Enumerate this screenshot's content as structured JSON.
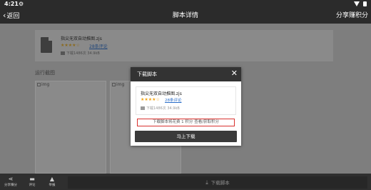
{
  "status_bar": {
    "time": "4:21",
    "settings_icon": "gear-icon",
    "wifi_icon": "wifi-icon",
    "battery_icon": "battery-icon"
  },
  "header": {
    "back_label": "返回",
    "title": "脚本详情",
    "share_label": "分享赚积分"
  },
  "script": {
    "name": "指尖无双自动推图.zjs",
    "stars": "★★★★☆",
    "comments": "28条评论",
    "downloads": "下载1486次 34.9kB"
  },
  "screenshots": {
    "label": "运行截图",
    "alt_text": "img"
  },
  "bottom_bar": {
    "items": [
      {
        "icon": "share-icon",
        "label": "分享赚分"
      },
      {
        "icon": "comment-icon",
        "label": "评论"
      },
      {
        "icon": "report-icon",
        "label": "举报"
      }
    ],
    "download_label": "下载脚本"
  },
  "dialog": {
    "title": "下载脚本",
    "close_icon": "close-icon",
    "script_name": "指尖无双自动推图.zjs",
    "stars": "★★★★☆",
    "comments": "28条评论",
    "downloads": "下载1486次 34.9kB",
    "notice_text": "下载脚本将花费 1 积分",
    "notice_link": "查看/获取积分",
    "button_label": "马上下载",
    "colors": {
      "notice_border": "#d9322e",
      "stars": "#f2a515",
      "link": "#2c6fc9",
      "header_bg": "#333333"
    }
  }
}
